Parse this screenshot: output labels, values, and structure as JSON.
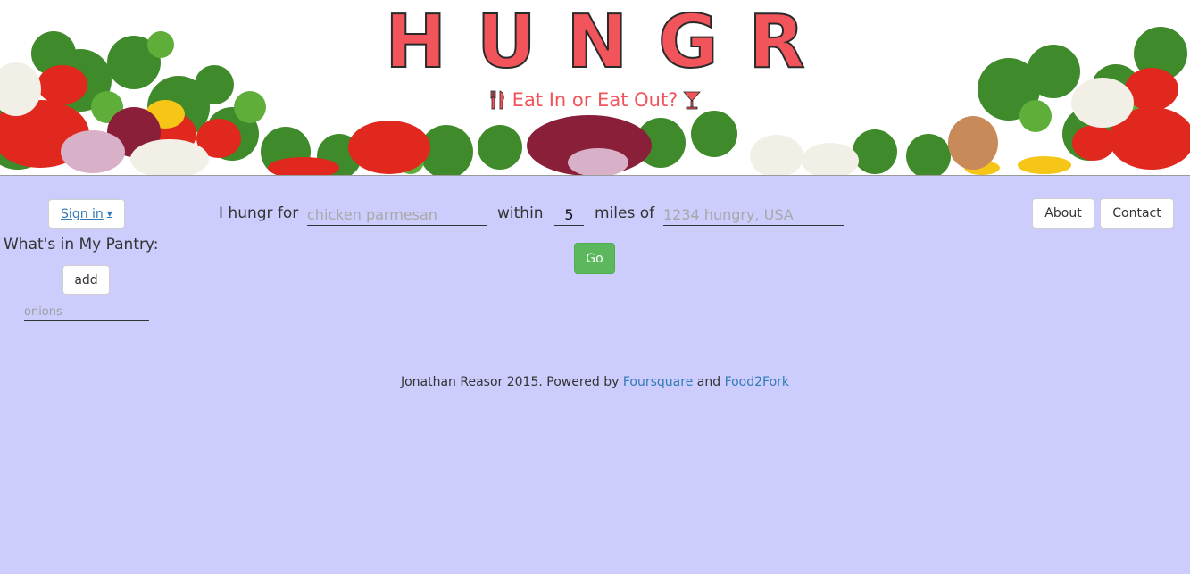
{
  "header": {
    "title": "HUNGR",
    "tagline": "Eat In or Eat Out?",
    "tagline_left_icon": "fork-knife-icon",
    "tagline_right_icon": "cocktail-glass-icon",
    "brand_color": "#f2545b"
  },
  "sidebar": {
    "signin_label": "Sign in",
    "pantry_title": "What's in My Pantry:",
    "add_label": "add",
    "pantry_placeholder": "onions"
  },
  "search": {
    "prefix": "I hungr for",
    "food_placeholder": "chicken parmesan",
    "within_label": "within",
    "miles_value": "5",
    "miles_label": "miles of",
    "location_placeholder": "1234 hungry, USA",
    "go_label": "Go"
  },
  "nav": {
    "about_label": "About",
    "contact_label": "Contact"
  },
  "footer": {
    "text": "Jonathan Reasor 2015. Powered by",
    "link1": "Foursquare",
    "joiner": "and",
    "link2": "Food2Fork"
  },
  "colors": {
    "background": "#ccccfd",
    "go_button": "#5cb85c",
    "link": "#337ab7"
  }
}
